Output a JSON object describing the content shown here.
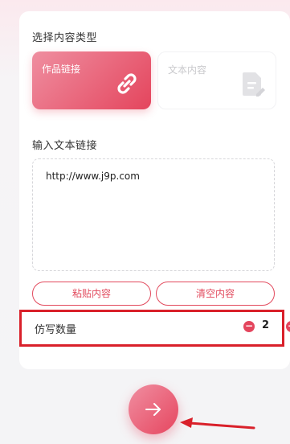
{
  "section_type": {
    "title": "选择内容类型",
    "options": [
      {
        "label": "作品链接",
        "icon": "link-icon",
        "selected": true
      },
      {
        "label": "文本内容",
        "icon": "document-edit-icon",
        "selected": false
      }
    ]
  },
  "section_input": {
    "title": "输入文本链接",
    "value": "http://www.j9p.com"
  },
  "actions": {
    "paste_label": "粘贴内容",
    "clear_label": "清空内容"
  },
  "quantity": {
    "label": "仿写数量",
    "value": "2",
    "minus_icon": "minus-circle-icon",
    "plus_icon": "plus-circle-icon"
  },
  "submit": {
    "icon": "arrow-right-icon"
  },
  "colors": {
    "accent": "#e4455d",
    "annotation": "#d9202a"
  }
}
